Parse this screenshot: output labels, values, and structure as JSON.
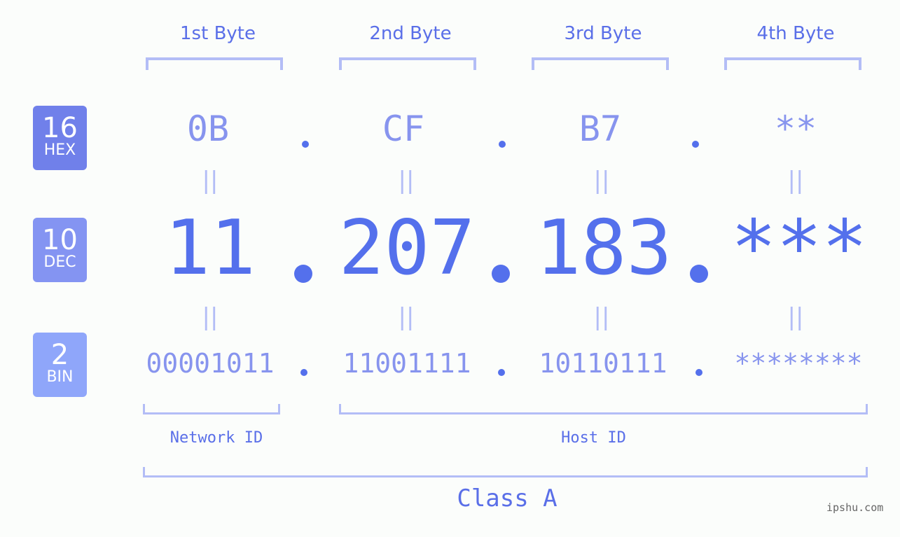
{
  "headers": [
    "1st Byte",
    "2nd Byte",
    "3rd Byte",
    "4th Byte"
  ],
  "badges": [
    {
      "num": "16",
      "label": "HEX",
      "color": "#7080ea"
    },
    {
      "num": "10",
      "label": "DEC",
      "color": "#8494f2"
    },
    {
      "num": "2",
      "label": "BIN",
      "color": "#8fa6fa"
    }
  ],
  "hex": [
    "0B",
    "CF",
    "B7",
    "**"
  ],
  "dec": [
    "11",
    "207",
    "183",
    "***"
  ],
  "bin": [
    "00001011",
    "11001111",
    "10110111",
    "********"
  ],
  "equals_sign": "||",
  "network_id_label": "Network ID",
  "host_id_label": "Host ID",
  "class_label": "Class A",
  "watermark": "ipshu.com",
  "colors": {
    "accent": "#5470ec",
    "light": "#8794ee",
    "bracket": "#b3bdf6"
  }
}
